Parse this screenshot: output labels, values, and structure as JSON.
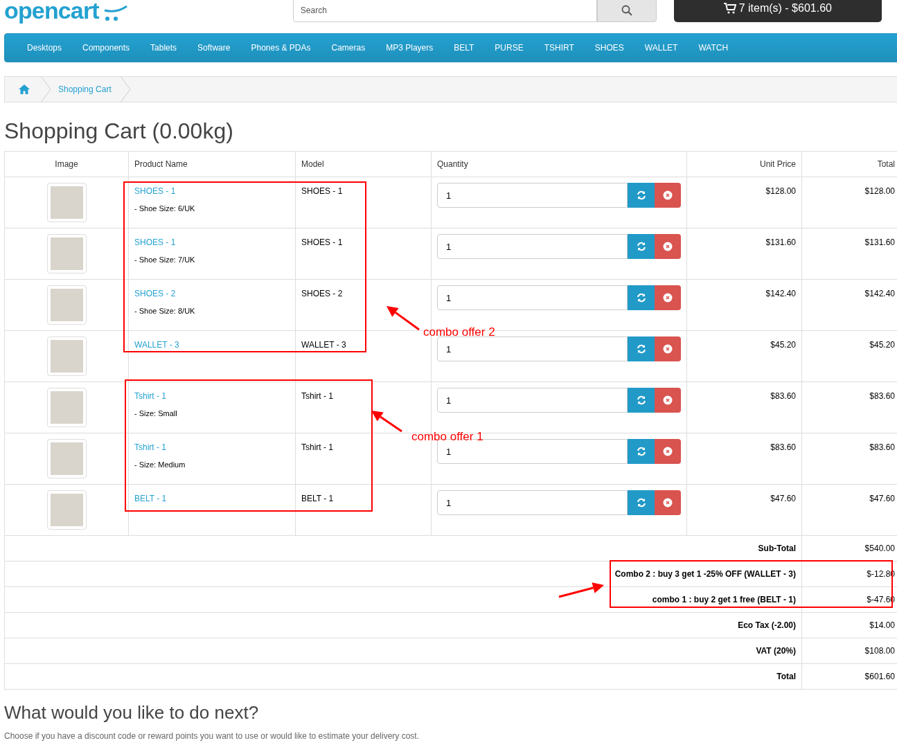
{
  "logo": {
    "text": "opencart"
  },
  "search": {
    "placeholder": "Search"
  },
  "cart_button": "7 item(s) - $601.60",
  "nav": [
    "Desktops",
    "Components",
    "Tablets",
    "Software",
    "Phones & PDAs",
    "Cameras",
    "MP3 Players",
    "BELT",
    "PURSE",
    "TSHIRT",
    "SHOES",
    "WALLET",
    "WATCH"
  ],
  "breadcrumb": [
    "Shopping Cart"
  ],
  "heading": "Shopping Cart (0.00kg)",
  "table": {
    "columns": [
      "Image",
      "Product Name",
      "Model",
      "Quantity",
      "Unit Price",
      "Total"
    ],
    "rows": [
      {
        "product": "SHOES - 1",
        "option": "- Shoe Size: 6/UK",
        "model": "SHOES - 1",
        "quantity": "1",
        "unit_price": "$128.00",
        "total": "$128.00"
      },
      {
        "product": "SHOES - 1",
        "option": "- Shoe Size: 7/UK",
        "model": "SHOES - 1",
        "quantity": "1",
        "unit_price": "$131.60",
        "total": "$131.60"
      },
      {
        "product": "SHOES - 2",
        "option": "- Shoe Size: 8/UK",
        "model": "SHOES - 2",
        "quantity": "1",
        "unit_price": "$142.40",
        "total": "$142.40"
      },
      {
        "product": "WALLET - 3",
        "model": "WALLET - 3",
        "quantity": "1",
        "unit_price": "$45.20",
        "total": "$45.20"
      },
      {
        "product": "Tshirt - 1",
        "option": "- Size: Small",
        "model": "Tshirt - 1",
        "quantity": "1",
        "unit_price": "$83.60",
        "total": "$83.60"
      },
      {
        "product": "Tshirt - 1",
        "option": "- Size: Medium",
        "model": "Tshirt - 1",
        "quantity": "1",
        "unit_price": "$83.60",
        "total": "$83.60"
      },
      {
        "product": "BELT - 1",
        "model": "BELT - 1",
        "quantity": "1",
        "unit_price": "$47.60",
        "total": "$47.60"
      }
    ],
    "totals": [
      {
        "label": "Sub-Total",
        "value": "$540.00"
      },
      {
        "label": "Combo 2 : buy 3 get 1 -25% OFF (WALLET - 3)",
        "value": "$-12.80"
      },
      {
        "label": "combo 1 : buy 2 get 1 free (BELT - 1)",
        "value": "$-47.60"
      },
      {
        "label": "Eco Tax (-2.00)",
        "value": "$14.00"
      },
      {
        "label": "VAT (20%)",
        "value": "$108.00"
      },
      {
        "label": "Total",
        "value": "$601.60"
      }
    ]
  },
  "annotations": [
    "combo offer 2",
    "combo offer 1"
  ],
  "next": {
    "heading": "What would you like to do next?",
    "text": "Choose if you have a discount code or reward points you want to use or would like to estimate your delivery cost."
  }
}
